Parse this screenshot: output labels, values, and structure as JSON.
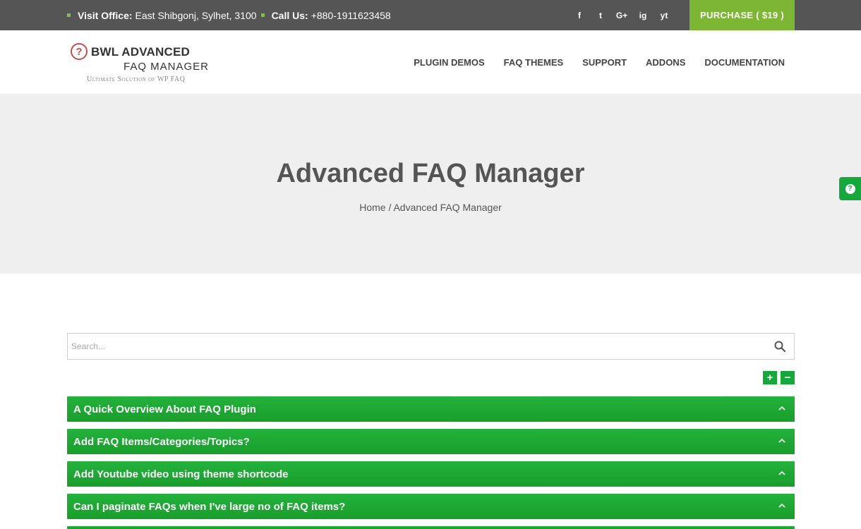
{
  "topbar": {
    "visit_label": "Visit Office:",
    "visit_value": "East Shibgonj, Sylhet, 3100",
    "call_label": "Call Us:",
    "call_value": "+880-1911623458",
    "social": [
      "f",
      "t",
      "G+",
      "ig",
      "yt"
    ],
    "purchase_label": "PURCHASE ( $19 )",
    "bullet_color": "#7cc243",
    "purchase_color": "#7db634"
  },
  "header": {
    "logo_line1": "BWL ADVANCED",
    "logo_line2": "FAQ MANAGER",
    "logo_tagline": "Ultimate Solution of WP FAQ",
    "nav": [
      "PLUGIN DEMOS",
      "FAQ THEMES",
      "SUPPORT",
      "ADDONS",
      "DOCUMENTATION"
    ]
  },
  "hero": {
    "title": "Advanced FAQ Manager",
    "breadcrumb": "Home / Advanced FAQ Manager"
  },
  "search": {
    "placeholder": "Search..."
  },
  "controls": {
    "expand": "+",
    "collapse": "−"
  },
  "faq": {
    "accent": "#1fa836",
    "items": [
      "A Quick Overview About FAQ Plugin",
      "Add FAQ Items/Categories/Topics?",
      "Add Youtube video using theme shortcode",
      "Can I paginate FAQs when I've large no of FAQ items?"
    ]
  }
}
